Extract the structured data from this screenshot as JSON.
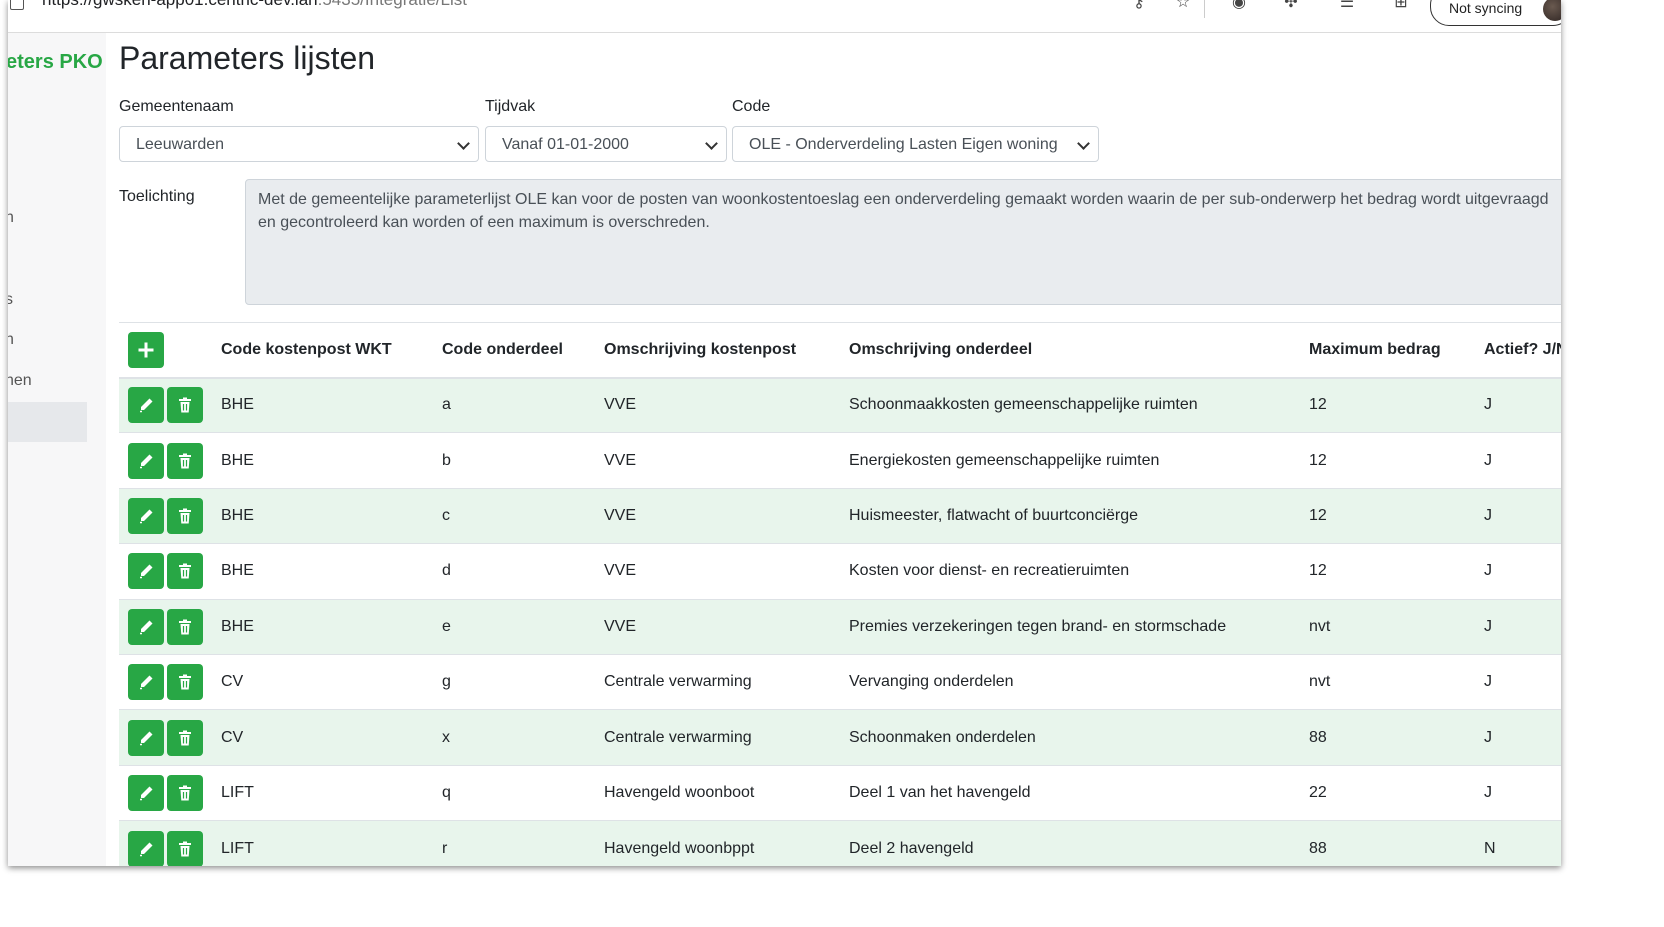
{
  "browser": {
    "url_main": "https://gwsken-app01.centric-dev.lan",
    "url_rest": ":5435/Integratie/List",
    "sync_label": "Not syncing"
  },
  "sidebar": {
    "brand": "eters PKO",
    "items": [
      "n",
      "s",
      "n",
      "nen"
    ]
  },
  "page": {
    "title": "Parameters lijsten"
  },
  "filters": {
    "gemeente_label": "Gemeentenaam",
    "gemeente_value": "Leeuwarden",
    "tijdvak_label": "Tijdvak",
    "tijdvak_value": "Vanaf 01-01-2000",
    "code_label": "Code",
    "code_value": "OLE - Onderverdeling Lasten Eigen woning"
  },
  "toelichting": {
    "label": "Toelichting",
    "text": "Met de gemeentelijke parameterlijst OLE kan voor de posten van woonkostentoeslag een onderverdeling gemaakt worden waarin de per sub-onderwerp het bedrag wordt uitgevraagd en gecontroleerd kan worden of een maximum is overschreden."
  },
  "table": {
    "headers": {
      "code_kostenpost": "Code kostenpost WKT",
      "code_onderdeel": "Code onderdeel",
      "omschrijving_kostenpost": "Omschrijving kostenpost",
      "omschrijving_onderdeel": "Omschrijving onderdeel",
      "maximum_bedrag": "Maximum bedrag",
      "actief": "Actief? J/N"
    },
    "rows": [
      {
        "code": "BHE",
        "onderdeel": "a",
        "kostenpost": "VVE",
        "omschrijving": "Schoonmaakkosten gemeenschappelijke ruimten",
        "max": "12",
        "actief": "J"
      },
      {
        "code": "BHE",
        "onderdeel": "b",
        "kostenpost": "VVE",
        "omschrijving": "Energiekosten gemeenschappelijke ruimten",
        "max": "12",
        "actief": "J"
      },
      {
        "code": "BHE",
        "onderdeel": "c",
        "kostenpost": "VVE",
        "omschrijving": "Huismeester, flatwacht of buurtconciërge",
        "max": "12",
        "actief": "J"
      },
      {
        "code": "BHE",
        "onderdeel": "d",
        "kostenpost": "VVE",
        "omschrijving": "Kosten voor dienst- en recreatieruimten",
        "max": "12",
        "actief": "J"
      },
      {
        "code": "BHE",
        "onderdeel": "e",
        "kostenpost": "VVE",
        "omschrijving": "Premies verzekeringen tegen brand- en stormschade",
        "max": "nvt",
        "actief": "J"
      },
      {
        "code": "CV",
        "onderdeel": "g",
        "kostenpost": "Centrale verwarming",
        "omschrijving": "Vervanging onderdelen",
        "max": "nvt",
        "actief": "J"
      },
      {
        "code": "CV",
        "onderdeel": "x",
        "kostenpost": "Centrale verwarming",
        "omschrijving": "Schoonmaken onderdelen",
        "max": "88",
        "actief": "J"
      },
      {
        "code": "LIFT",
        "onderdeel": "q",
        "kostenpost": "Havengeld woonboot",
        "omschrijving": "Deel 1 van het havengeld",
        "max": "22",
        "actief": "J"
      },
      {
        "code": "LIFT",
        "onderdeel": "r",
        "kostenpost": "Havengeld woonbppt",
        "omschrijving": "Deel 2 havengeld",
        "max": "88",
        "actief": "N"
      }
    ]
  },
  "colors": {
    "accent_green": "#28a745",
    "row_stripe": "#e8f5ec"
  },
  "icons": {
    "add": "plus-icon",
    "edit": "pencil-icon",
    "delete": "trash-icon"
  }
}
